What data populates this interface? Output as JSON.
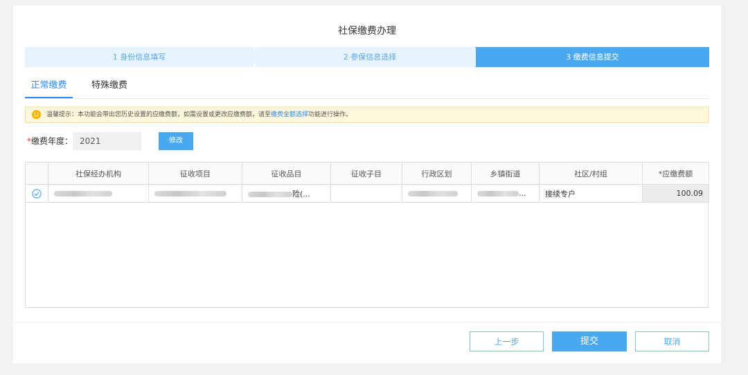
{
  "page": {
    "title": "社保缴费办理"
  },
  "steps": [
    {
      "label": "1 身份信息填写"
    },
    {
      "label": "2 参保信息选择"
    },
    {
      "label": "3 缴费信息提交"
    }
  ],
  "tabs": [
    {
      "label": "正常缴费",
      "active": true
    },
    {
      "label": "特殊缴费",
      "active": false
    }
  ],
  "notice": {
    "prefix": "温馨提示：本功能会带出您历史设置的应缴费额，如需设置或更改应缴费额，请至",
    "link": "缴费金额选择",
    "suffix": "功能进行操作。"
  },
  "year": {
    "required_mark": "*",
    "label": "缴费年度：",
    "value": "2021",
    "edit_label": "修改"
  },
  "table": {
    "headers": [
      "",
      "社保经办机构",
      "征收项目",
      "征收品目",
      "征收子目",
      "行政区划",
      "乡镇街道",
      "社区/村组",
      "*应缴费额"
    ],
    "rows": [
      {
        "checked": true,
        "agency": "",
        "project": "",
        "item_visible": "险(...",
        "subitem": "",
        "region": "",
        "street_visible": "...",
        "community": "接续专户",
        "amount": "100.09"
      }
    ]
  },
  "footer": {
    "prev": "上一步",
    "submit": "提交",
    "cancel": "取消"
  },
  "colors": {
    "accent": "#4aa8ef",
    "step_inactive_bg": "#e7f3fd",
    "notice_bg": "#fdf7dc",
    "required": "#e4393c"
  }
}
